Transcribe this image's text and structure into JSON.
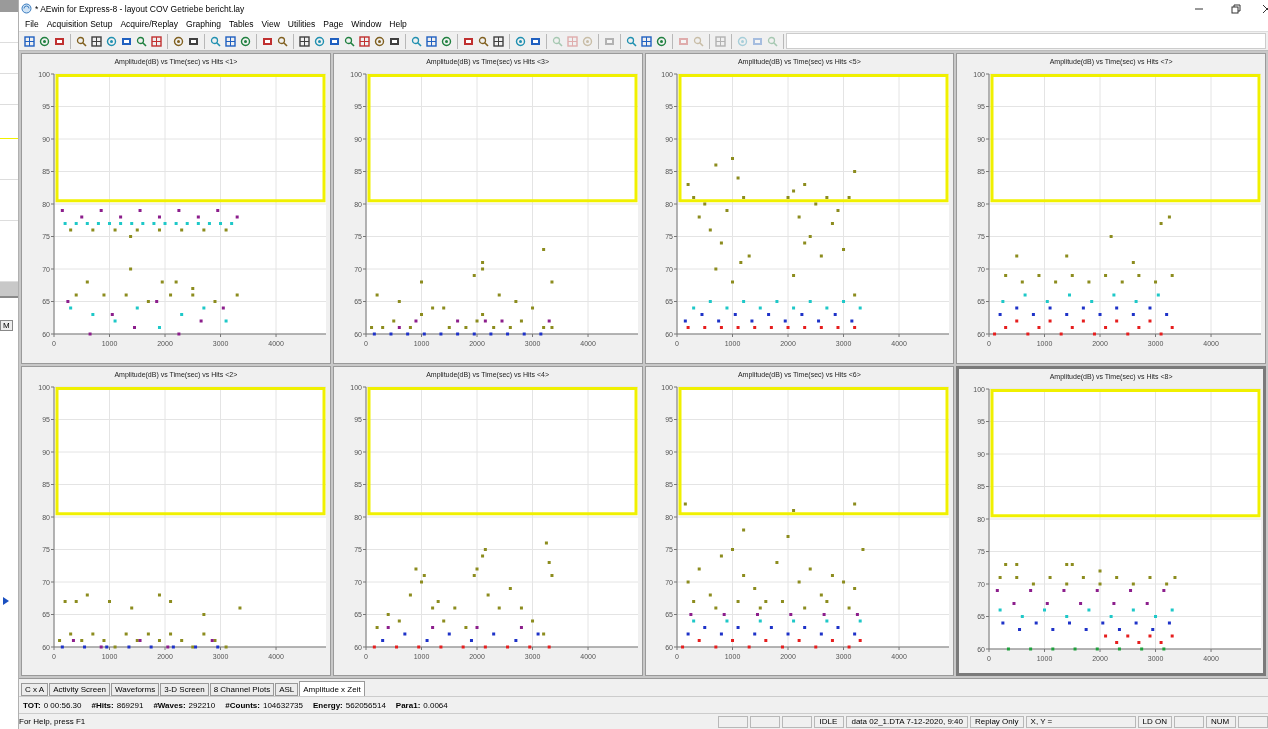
{
  "window": {
    "title": "* AEwin for Express-8 - layout COV Getriebe bericht.lay"
  },
  "behind_window": {
    "label": "M"
  },
  "menu": [
    "File",
    "Acquisition Setup",
    "Acquire/Replay",
    "Graphing",
    "Tables",
    "View",
    "Utilities",
    "Page",
    "Window",
    "Help"
  ],
  "toolbar": [
    {
      "buttons": [
        {
          "disabled": false
        },
        {
          "disabled": false
        },
        {
          "disabled": false
        }
      ]
    },
    {
      "buttons": [
        {
          "disabled": false
        },
        {
          "disabled": false
        },
        {
          "disabled": false
        },
        {
          "disabled": false
        },
        {
          "disabled": false
        },
        {
          "disabled": false
        }
      ]
    },
    {
      "buttons": [
        {
          "disabled": false
        },
        {
          "disabled": false
        }
      ]
    },
    {
      "buttons": [
        {
          "disabled": false
        },
        {
          "disabled": false
        },
        {
          "disabled": false
        }
      ]
    },
    {
      "buttons": [
        {
          "disabled": false
        },
        {
          "disabled": false
        }
      ]
    },
    {
      "buttons": [
        {
          "disabled": false
        },
        {
          "disabled": false
        },
        {
          "disabled": false
        },
        {
          "disabled": false
        },
        {
          "disabled": false
        },
        {
          "disabled": false
        },
        {
          "disabled": false
        }
      ]
    },
    {
      "buttons": [
        {
          "disabled": false
        },
        {
          "disabled": false
        },
        {
          "disabled": false
        }
      ]
    },
    {
      "buttons": [
        {
          "disabled": false
        },
        {
          "disabled": false
        },
        {
          "disabled": false
        }
      ]
    },
    {
      "buttons": [
        {
          "disabled": false
        },
        {
          "disabled": false
        }
      ]
    },
    {
      "buttons": [
        {
          "disabled": true
        },
        {
          "disabled": true
        },
        {
          "disabled": true
        }
      ]
    },
    {
      "buttons": [
        {
          "disabled": true
        }
      ]
    },
    {
      "buttons": [
        {
          "disabled": false
        },
        {
          "disabled": false
        },
        {
          "disabled": false
        }
      ]
    },
    {
      "buttons": [
        {
          "disabled": true
        },
        {
          "disabled": true
        }
      ]
    },
    {
      "buttons": [
        {
          "disabled": true
        }
      ]
    },
    {
      "buttons": [
        {
          "disabled": true
        },
        {
          "disabled": true
        },
        {
          "disabled": true
        }
      ]
    }
  ],
  "charts": [
    {
      "selected": false,
      "selection_frame": true,
      "chart_data": {
        "type": "scatter",
        "title": "Amplitude(dB) vs Time(sec) vs Hits <1>",
        "grid": true,
        "xlim": [
          0,
          4900
        ],
        "ylim": [
          60,
          100
        ],
        "xticks": [
          0,
          1000,
          2000,
          3000,
          4000
        ],
        "yticks": [
          60,
          65,
          70,
          75,
          80,
          85,
          90,
          95,
          100
        ],
        "series": [
          {
            "color": "#1ec8c8",
            "x": [
              200,
              400,
              600,
              800,
              1000,
              1200,
              1400,
              1600,
              1800,
              2000,
              2200,
              2400,
              2600,
              2800,
              3000,
              3200,
              300,
              700,
              1100,
              1500,
              1900,
              2300,
              2700,
              3100
            ],
            "values": [
              77,
              77,
              77,
              77,
              77,
              77,
              77,
              77,
              77,
              77,
              77,
              77,
              77,
              77,
              77,
              77,
              64,
              63,
              62,
              64,
              61,
              63,
              64,
              62
            ]
          },
          {
            "color": "#8c1e8c",
            "x": [
              150,
              500,
              850,
              1200,
              1550,
              1900,
              2250,
              2600,
              2950,
              3300,
              250,
              650,
              1050,
              1450,
              1850,
              2250,
              2650,
              3050
            ],
            "values": [
              79,
              78,
              79,
              78,
              79,
              78,
              79,
              78,
              79,
              78,
              65,
              60,
              63,
              61,
              65,
              60,
              62,
              64
            ]
          },
          {
            "color": "#8c8c1e",
            "x": [
              300,
              700,
              1100,
              1500,
              1900,
              2300,
              2700,
              3100,
              1380,
              1380,
              600,
              1950,
              2200,
              2500,
              400,
              900,
              1300,
              1700,
              2100,
              2500,
              2900,
              3300
            ],
            "values": [
              76,
              76,
              76,
              76,
              76,
              76,
              76,
              76,
              75,
              70,
              68,
              68,
              68,
              67,
              66,
              66,
              66,
              65,
              66,
              66,
              65,
              66
            ]
          }
        ]
      }
    },
    {
      "selected": false,
      "selection_frame": true,
      "chart_data": {
        "type": "scatter",
        "title": "Amplitude(dB) vs Time(sec) vs Hits <3>",
        "grid": true,
        "xlim": [
          0,
          4900
        ],
        "ylim": [
          60,
          100
        ],
        "xticks": [
          0,
          1000,
          2000,
          3000,
          4000
        ],
        "yticks": [
          60,
          65,
          70,
          75,
          80,
          85,
          90,
          95,
          100
        ],
        "series": [
          {
            "color": "#8c8c1e",
            "x": [
              100,
              300,
              500,
              800,
              1000,
              1200,
              1500,
              1800,
              2000,
              2100,
              2300,
              2600,
              2800,
              3000,
              3200,
              3350,
              200,
              600,
              1000,
              1400,
              2100,
              2400,
              2700,
              1950,
              2100,
              3200,
              3350
            ],
            "values": [
              61,
              61,
              62,
              61,
              63,
              64,
              61,
              61,
              62,
              63,
              61,
              61,
              62,
              64,
              61,
              61,
              66,
              65,
              68,
              64,
              71,
              66,
              65,
              69,
              70,
              73,
              68
            ]
          },
          {
            "color": "#1e32c8",
            "x": [
              150,
              450,
              750,
              1050,
              1350,
              1650,
              1950,
              2250,
              2550,
              2850,
              3150
            ],
            "values": [
              60,
              60,
              60,
              60,
              60,
              60,
              60,
              60,
              60,
              60,
              60
            ]
          },
          {
            "color": "#8c1e8c",
            "x": [
              600,
              900,
              1650,
              2150,
              2450,
              3300
            ],
            "values": [
              61,
              62,
              62,
              62,
              62,
              62
            ]
          }
        ]
      }
    },
    {
      "selected": false,
      "selection_frame": true,
      "chart_data": {
        "type": "scatter",
        "title": "Amplitude(dB) vs Time(sec) vs Hits <5>",
        "grid": true,
        "xlim": [
          0,
          4900
        ],
        "ylim": [
          60,
          100
        ],
        "xticks": [
          0,
          1000,
          2000,
          3000,
          4000
        ],
        "yticks": [
          60,
          65,
          70,
          75,
          80,
          85,
          90,
          95,
          100
        ],
        "series": [
          {
            "color": "#8c8c1e",
            "x": [
              200,
              300,
              400,
              500,
              600,
              700,
              800,
              900,
              1000,
              1100,
              1200,
              1300,
              2000,
              2100,
              2200,
              2300,
              2400,
              2500,
              2600,
              2700,
              2800,
              2900,
              3000,
              3100,
              3200,
              700,
              1000,
              1150,
              2100,
              2300,
              3200
            ],
            "values": [
              83,
              81,
              78,
              80,
              76,
              86,
              74,
              79,
              87,
              84,
              81,
              72,
              81,
              82,
              78,
              83,
              75,
              80,
              72,
              81,
              77,
              79,
              73,
              81,
              85,
              70,
              68,
              71,
              69,
              74,
              66
            ]
          },
          {
            "color": "#e61e1e",
            "x": [
              200,
              500,
              800,
              1100,
              1400,
              1700,
              2000,
              2300,
              2600,
              2900,
              3200
            ],
            "values": [
              61,
              61,
              61,
              61,
              61,
              61,
              61,
              61,
              61,
              61,
              61
            ]
          },
          {
            "color": "#1e32c8",
            "x": [
              150,
              450,
              750,
              1050,
              1350,
              1650,
              1950,
              2250,
              2550,
              2850,
              3150
            ],
            "values": [
              62,
              63,
              62,
              63,
              62,
              63,
              62,
              63,
              62,
              63,
              62
            ]
          },
          {
            "color": "#1ec8c8",
            "x": [
              300,
              600,
              900,
              1200,
              1500,
              1800,
              2100,
              2400,
              2700,
              3000,
              3300
            ],
            "values": [
              64,
              65,
              64,
              65,
              64,
              65,
              64,
              65,
              64,
              65,
              64
            ]
          }
        ]
      }
    },
    {
      "selected": false,
      "selection_frame": true,
      "chart_data": {
        "type": "scatter",
        "title": "Amplitude(dB) vs Time(sec) vs Hits <7>",
        "grid": true,
        "xlim": [
          0,
          4900
        ],
        "ylim": [
          60,
          100
        ],
        "xticks": [
          0,
          1000,
          2000,
          3000,
          4000
        ],
        "yticks": [
          60,
          65,
          70,
          75,
          80,
          85,
          90,
          95,
          100
        ],
        "series": [
          {
            "color": "#8c8c1e",
            "x": [
              300,
              600,
              900,
              1200,
              1500,
              1800,
              2100,
              2400,
              2700,
              3000,
              3300,
              500,
              1400,
              2200,
              2600,
              3100,
              3250
            ],
            "values": [
              69,
              68,
              69,
              68,
              69,
              68,
              69,
              68,
              69,
              68,
              69,
              72,
              72,
              75,
              71,
              77,
              78
            ]
          },
          {
            "color": "#e61e1e",
            "x": [
              100,
              300,
              500,
              700,
              900,
              1100,
              1300,
              1500,
              1700,
              1900,
              2100,
              2300,
              2500,
              2700,
              2900,
              3100,
              3300
            ],
            "values": [
              60,
              61,
              62,
              60,
              61,
              62,
              60,
              61,
              62,
              60,
              61,
              62,
              60,
              61,
              62,
              60,
              61
            ]
          },
          {
            "color": "#1e32c8",
            "x": [
              200,
              500,
              800,
              1100,
              1400,
              1700,
              2000,
              2300,
              2600,
              2900,
              3200
            ],
            "values": [
              63,
              64,
              63,
              64,
              63,
              64,
              63,
              64,
              63,
              64,
              63
            ]
          },
          {
            "color": "#1ec8c8",
            "x": [
              250,
              650,
              1050,
              1450,
              1850,
              2250,
              2650,
              3050
            ],
            "values": [
              65,
              66,
              65,
              66,
              65,
              66,
              65,
              66
            ]
          }
        ]
      }
    },
    {
      "selected": false,
      "selection_frame": true,
      "chart_data": {
        "type": "scatter",
        "title": "Amplitude(dB) vs Time(sec) vs Hits <2>",
        "grid": true,
        "xlim": [
          0,
          4900
        ],
        "ylim": [
          60,
          100
        ],
        "xticks": [
          0,
          1000,
          2000,
          3000,
          4000
        ],
        "yticks": [
          60,
          65,
          70,
          75,
          80,
          85,
          90,
          95,
          100
        ],
        "series": [
          {
            "color": "#8c8c1e",
            "x": [
              100,
              300,
              500,
              700,
              900,
              1100,
              1300,
              1500,
              1700,
              1900,
              2100,
              2300,
              2500,
              2700,
              2900,
              3100,
              3350,
              200,
              400,
              600,
              1000,
              1400,
              1900,
              2100,
              2700
            ],
            "values": [
              61,
              62,
              61,
              62,
              61,
              60,
              62,
              61,
              62,
              61,
              62,
              61,
              60,
              62,
              61,
              60,
              66,
              67,
              67,
              68,
              67,
              66,
              68,
              67,
              65
            ]
          },
          {
            "color": "#1e32c8",
            "x": [
              150,
              550,
              950,
              1350,
              1750,
              2150,
              2550,
              2950
            ],
            "values": [
              60,
              60,
              60,
              60,
              60,
              60,
              60,
              60
            ]
          },
          {
            "color": "#8c1e8c",
            "x": [
              350,
              850,
              1550,
              2050,
              2850
            ],
            "values": [
              61,
              60,
              61,
              60,
              61
            ]
          }
        ]
      }
    },
    {
      "selected": false,
      "selection_frame": true,
      "chart_data": {
        "type": "scatter",
        "title": "Amplitude(dB) vs Time(sec) vs Hits <4>",
        "grid": true,
        "xlim": [
          0,
          4900
        ],
        "ylim": [
          60,
          100
        ],
        "xticks": [
          0,
          1000,
          2000,
          3000,
          4000
        ],
        "yticks": [
          60,
          65,
          70,
          75,
          80,
          85,
          90,
          95,
          100
        ],
        "series": [
          {
            "color": "#8c8c1e",
            "x": [
              200,
              400,
              600,
              800,
              1000,
              1200,
              1400,
              1600,
              1800,
              2000,
              2100,
              2200,
              2400,
              2600,
              2800,
              3000,
              3200,
              3350,
              900,
              1050,
              1300,
              1950,
              2150,
              3250,
              3300
            ],
            "values": [
              63,
              65,
              64,
              68,
              70,
              66,
              64,
              66,
              63,
              72,
              74,
              68,
              66,
              69,
              66,
              64,
              62,
              71,
              72,
              71,
              67,
              71,
              75,
              76,
              73
            ]
          },
          {
            "color": "#e61e1e",
            "x": [
              150,
              550,
              950,
              1350,
              1750,
              2150,
              2550,
              2950,
              3300
            ],
            "values": [
              60,
              60,
              60,
              60,
              60,
              60,
              60,
              60,
              60
            ]
          },
          {
            "color": "#1e32c8",
            "x": [
              300,
              700,
              1100,
              1500,
              1900,
              2300,
              2700,
              3100
            ],
            "values": [
              61,
              62,
              61,
              62,
              61,
              62,
              61,
              62
            ]
          },
          {
            "color": "#8c1e8c",
            "x": [
              400,
              1200,
              2000,
              2800
            ],
            "values": [
              63,
              63,
              63,
              63
            ]
          }
        ]
      }
    },
    {
      "selected": false,
      "selection_frame": true,
      "chart_data": {
        "type": "scatter",
        "title": "Amplitude(dB) vs Time(sec) vs Hits <6>",
        "grid": true,
        "xlim": [
          0,
          4900
        ],
        "ylim": [
          60,
          100
        ],
        "xticks": [
          0,
          1000,
          2000,
          3000,
          4000
        ],
        "yticks": [
          60,
          65,
          70,
          75,
          80,
          85,
          90,
          95,
          100
        ],
        "series": [
          {
            "color": "#8c8c1e",
            "x": [
              150,
              2100,
              3200,
              1200,
              3350,
              200,
              400,
              600,
              800,
              1000,
              1200,
              1400,
              1600,
              1800,
              2000,
              2200,
              2400,
              2600,
              2800,
              3000,
              3200,
              300,
              700,
              1100,
              1500,
              1900,
              2300,
              2700,
              3100
            ],
            "values": [
              82,
              81,
              82,
              78,
              75,
              70,
              72,
              68,
              74,
              75,
              71,
              69,
              67,
              73,
              77,
              70,
              72,
              68,
              71,
              70,
              69,
              67,
              66,
              67,
              66,
              67,
              66,
              67,
              66
            ]
          },
          {
            "color": "#e61e1e",
            "x": [
              100,
              400,
              700,
              1000,
              1300,
              1600,
              1900,
              2200,
              2500,
              2800,
              3100,
              3300
            ],
            "values": [
              60,
              61,
              60,
              61,
              60,
              61,
              60,
              61,
              60,
              61,
              60,
              61
            ]
          },
          {
            "color": "#1e32c8",
            "x": [
              200,
              500,
              800,
              1100,
              1400,
              1700,
              2000,
              2300,
              2600,
              2900,
              3200
            ],
            "values": [
              62,
              63,
              62,
              63,
              62,
              63,
              62,
              63,
              62,
              63,
              62
            ]
          },
          {
            "color": "#1ec8c8",
            "x": [
              300,
              900,
              1500,
              2100,
              2700,
              3300
            ],
            "values": [
              64,
              64,
              64,
              64,
              64,
              64
            ]
          },
          {
            "color": "#8c1e8c",
            "x": [
              250,
              850,
              1450,
              2050,
              2650,
              3250
            ],
            "values": [
              65,
              65,
              65,
              65,
              65,
              65
            ]
          }
        ]
      }
    },
    {
      "selected": true,
      "selection_frame": true,
      "chart_data": {
        "type": "scatter",
        "title": "Amplitude(dB) vs Time(sec) vs Hits <8>",
        "grid": true,
        "xlim": [
          0,
          4900
        ],
        "ylim": [
          60,
          100
        ],
        "xticks": [
          0,
          1000,
          2000,
          3000,
          4000
        ],
        "yticks": [
          60,
          65,
          70,
          75,
          80,
          85,
          90,
          95,
          100
        ],
        "series": [
          {
            "color": "#8c8c1e",
            "x": [
              300,
              500,
              1400,
              1500,
              2000,
              200,
              500,
              800,
              1100,
              1400,
              1700,
              2000,
              2300,
              2600,
              2900,
              3200,
              3350
            ],
            "values": [
              73,
              73,
              73,
              73,
              72,
              71,
              71,
              70,
              71,
              70,
              71,
              70,
              71,
              70,
              71,
              70,
              71
            ]
          },
          {
            "color": "#8c1e8c",
            "x": [
              150,
              450,
              750,
              1050,
              1350,
              1650,
              1950,
              2250,
              2550,
              2850,
              3150
            ],
            "values": [
              69,
              67,
              69,
              67,
              69,
              67,
              69,
              67,
              69,
              67,
              69
            ]
          },
          {
            "color": "#1ec8c8",
            "x": [
              200,
              600,
              1000,
              1400,
              1800,
              2200,
              2600,
              3000,
              3300
            ],
            "values": [
              66,
              65,
              66,
              65,
              66,
              65,
              66,
              65,
              66
            ]
          },
          {
            "color": "#1e32c8",
            "x": [
              250,
              550,
              850,
              1150,
              1450,
              1750,
              2050,
              2350,
              2650,
              2950,
              3250
            ],
            "values": [
              64,
              63,
              64,
              63,
              64,
              63,
              64,
              63,
              64,
              63,
              64
            ]
          },
          {
            "color": "#e61e1e",
            "x": [
              2100,
              2300,
              2500,
              2700,
              2900,
              3100,
              3300
            ],
            "values": [
              62,
              61,
              62,
              61,
              62,
              61,
              62
            ]
          },
          {
            "color": "#1ea03c",
            "x": [
              350,
              750,
              1150,
              1550,
              1950,
              2350,
              2750,
              3150
            ],
            "values": [
              60,
              60,
              60,
              60,
              60,
              60,
              60,
              60
            ]
          }
        ]
      }
    }
  ],
  "tabs": [
    {
      "label": "C x A",
      "selected": false
    },
    {
      "label": "Activity Screen",
      "selected": false
    },
    {
      "label": "Waveforms",
      "selected": false
    },
    {
      "label": "3-D Screen",
      "selected": false
    },
    {
      "label": "8 Channel Plots",
      "selected": false
    },
    {
      "label": "ASL",
      "selected": false
    },
    {
      "label": "Amplitude x Zeit",
      "selected": true
    }
  ],
  "stats": [
    {
      "label": "TOT:",
      "value": "0 00:56.30"
    },
    {
      "label": "#Hits:",
      "value": "869291"
    },
    {
      "label": "#Waves:",
      "value": "292210"
    },
    {
      "label": "#Counts:",
      "value": "104632735"
    },
    {
      "label": "Energy:",
      "value": "562056514"
    },
    {
      "label": "Para1:",
      "value": "0.0064"
    }
  ],
  "status_bar": {
    "help": "For Help, press F1",
    "panes": [
      {
        "kind": "blank"
      },
      {
        "kind": "blank"
      },
      {
        "kind": "blank"
      },
      {
        "kind": "text",
        "text": "IDLE"
      },
      {
        "kind": "text",
        "text": "data 02_1.DTA  7-12-2020, 9:40"
      },
      {
        "kind": "text",
        "text": "Replay Only"
      },
      {
        "kind": "wide",
        "text": "X, Y ="
      },
      {
        "kind": "text",
        "text": "LD ON"
      },
      {
        "kind": "blank"
      },
      {
        "kind": "text",
        "text": "NUM"
      },
      {
        "kind": "blank"
      }
    ]
  }
}
